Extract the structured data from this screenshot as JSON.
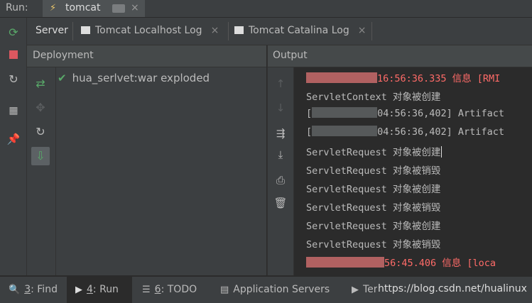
{
  "run_bar": {
    "label": "Run:",
    "tab_title": "tomcat",
    "tab_icon": "tomcat-icon",
    "close": "×"
  },
  "tabs": [
    {
      "label": "Server",
      "active": true
    },
    {
      "label": "Tomcat Localhost Log",
      "close": "×"
    },
    {
      "label": "Tomcat Catalina Log",
      "close": "×"
    }
  ],
  "deployment": {
    "header": "Deployment",
    "item": "hua_serlvet:war exploded"
  },
  "output": {
    "header": "Output",
    "lines": [
      {
        "text": "16:56:36.335 信息 [RMI",
        "color": "#ff6b68",
        "redacted": true
      },
      {
        "text": "ServletContext 对象被创建"
      },
      {
        "text": "04:56:36,402] Artifact",
        "prefix": "[",
        "redacted": true
      },
      {
        "text": "04:56:36,402] Artifact",
        "prefix": "[",
        "redacted": true
      },
      {
        "text": "ServletRequest 对象被创建",
        "caret": true
      },
      {
        "text": "ServletRequest 对象被销毁"
      },
      {
        "text": "ServletRequest 对象被创建"
      },
      {
        "text": "ServletRequest 对象被销毁"
      },
      {
        "text": "ServletRequest 对象被创建"
      },
      {
        "text": "ServletRequest 对象被销毁"
      },
      {
        "text": "56:45.406 信息 [loca",
        "color": "#ff6b68",
        "redacted": true
      }
    ]
  },
  "bottom_tabs": [
    {
      "num": "3",
      "label": ": Find"
    },
    {
      "num": "4",
      "label": ": Run",
      "active": true
    },
    {
      "num": "6",
      "label": ": TODO"
    },
    {
      "label": "Application Servers"
    },
    {
      "label": "Terminal"
    }
  ],
  "watermark": "https://blog.csdn.net/hualinux",
  "colors": {
    "background": "#2b2b2b",
    "panel": "#3c3f41",
    "error_text": "#ff6b68",
    "success_green": "#59a869"
  }
}
